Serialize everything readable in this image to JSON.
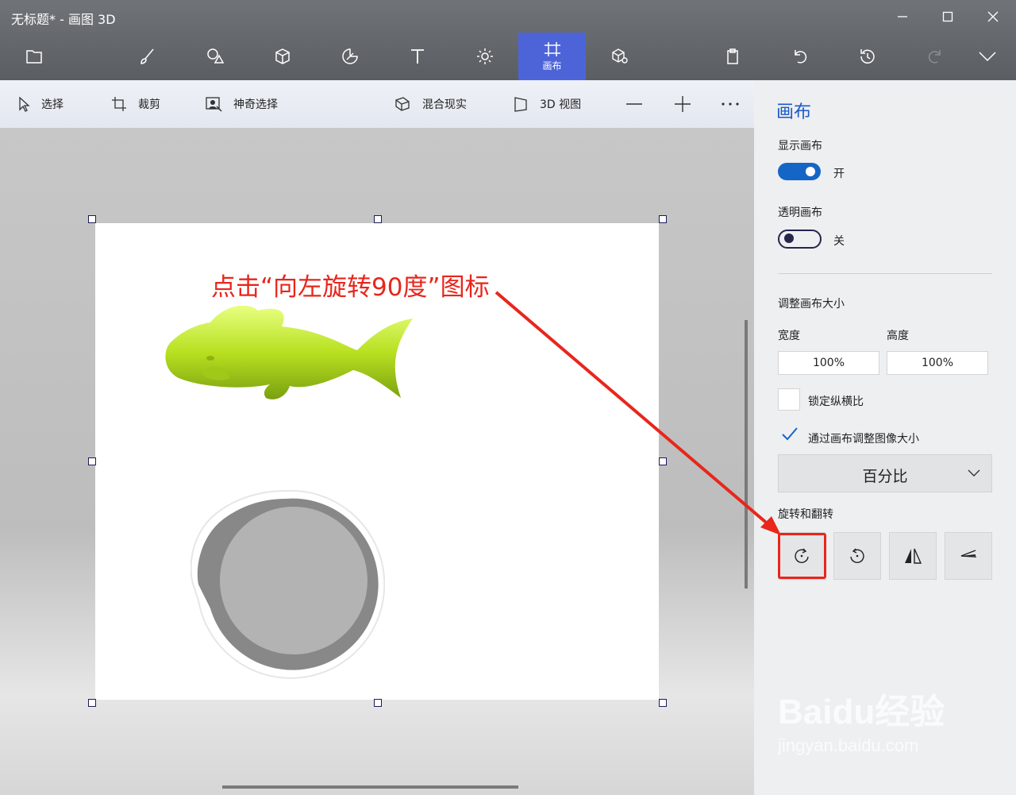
{
  "window": {
    "title": "无标题* - 画图 3D"
  },
  "ribbon": {
    "tools": [
      "menu-icon",
      "brush-icon",
      "2d-shapes-icon",
      "3d-shapes-icon",
      "stickers-icon",
      "text-icon",
      "effects-icon",
      "canvas-icon",
      "3d-library-icon"
    ],
    "active_tool_label": "画布",
    "right_icons": [
      "paste-icon",
      "undo-icon",
      "history-icon",
      "redo-icon",
      "expand-icon"
    ]
  },
  "commandbar": {
    "select": "选择",
    "crop": "裁剪",
    "magic_select": "神奇选择",
    "mixed_reality": "混合现实",
    "view_3d": "3D 视图"
  },
  "annotation": {
    "text": "点击“向左旋转90度”图标"
  },
  "panel": {
    "title": "画布",
    "show_canvas_label": "显示画布",
    "show_canvas_state": "开",
    "show_canvas_on": true,
    "transparent_canvas_label": "透明画布",
    "transparent_canvas_state": "关",
    "transparent_canvas_on": false,
    "resize_heading": "调整画布大小",
    "width_label": "宽度",
    "height_label": "高度",
    "width_value": "100%",
    "height_value": "100%",
    "lock_aspect_label": "锁定纵横比",
    "lock_aspect_checked": false,
    "resize_image_label": "通过画布调整图像大小",
    "resize_image_checked": true,
    "unit_select": "百分比",
    "rotate_heading": "旋转和翻转",
    "rotate_buttons": [
      "rotate-left-icon",
      "rotate-right-icon",
      "flip-horizontal-icon",
      "flip-vertical-icon"
    ]
  },
  "watermark": {
    "brand": "Baidu经验",
    "url": "jingyan.baidu.com"
  },
  "colors": {
    "accent": "#4d64d8",
    "toggle_on": "#1565c7",
    "annotation_red": "#e8261c",
    "fish_green": "#b8e020"
  }
}
